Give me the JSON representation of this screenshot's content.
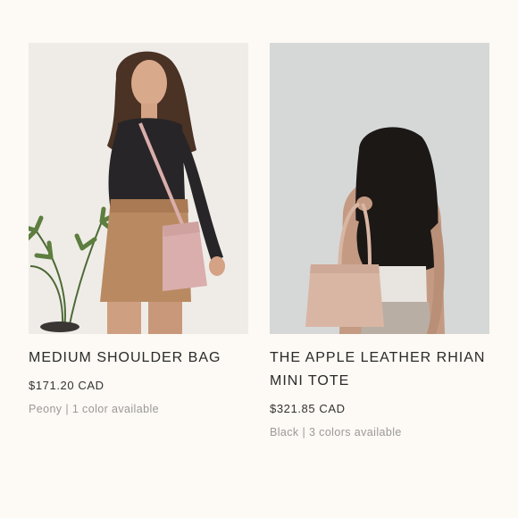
{
  "products": [
    {
      "title": "MEDIUM SHOULDER BAG",
      "price": "$171.20 CAD",
      "variant": "Peony | 1 color available",
      "image_icon": "product-photo-model-shoulder-bag",
      "colors": {
        "background": "#e9e6e2",
        "bag": "#d9aeac",
        "top": "#272527",
        "skirt": "#b98a62"
      }
    },
    {
      "title": "THE APPLE LEATHER RHIAN MINI TOTE",
      "price": "$321.85 CAD",
      "variant": "Black | 3 colors available",
      "image_icon": "product-photo-model-mini-tote",
      "colors": {
        "background": "#d2d4d4",
        "bag": "#d9b6a4",
        "hair": "#1c1816",
        "skin": "#c49a83"
      }
    }
  ],
  "theme": {
    "page_background": "#fdf9f4",
    "text_primary": "#2a2a2a",
    "text_muted": "#9a9a9a"
  }
}
